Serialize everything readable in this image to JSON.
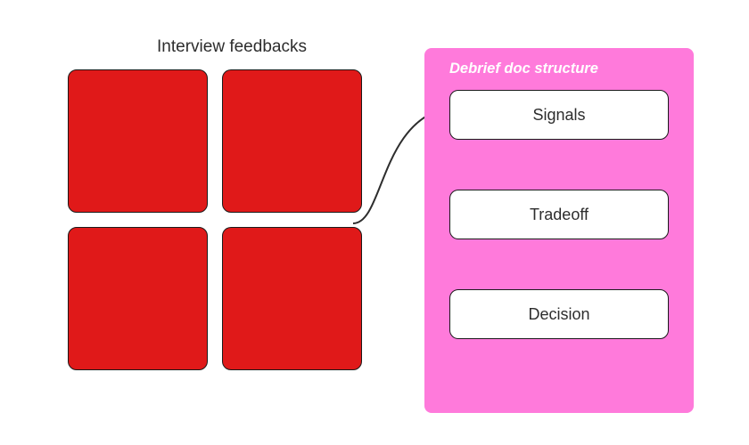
{
  "left": {
    "title": "Interview feedbacks",
    "boxes_count": 4
  },
  "right": {
    "title": "Debrief doc structure",
    "items": [
      "Signals",
      "Tradeoff",
      "Decision"
    ]
  },
  "colors": {
    "red": "#e01919",
    "pink": "#ff7adb",
    "stroke": "#1a1a1a"
  }
}
